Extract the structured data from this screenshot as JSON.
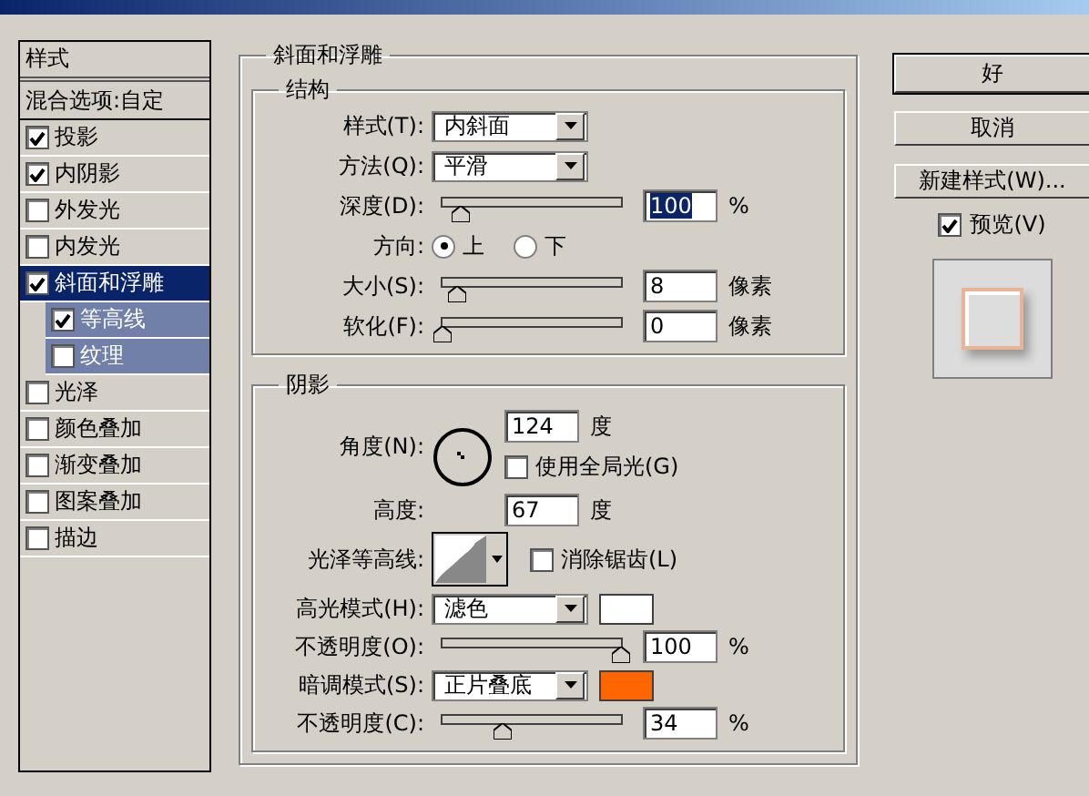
{
  "sidebar": {
    "header": "样式",
    "blend": "混合选项:自定",
    "items": [
      {
        "label": "投影",
        "checked": true,
        "selected": false
      },
      {
        "label": "内阴影",
        "checked": true,
        "selected": false
      },
      {
        "label": "外发光",
        "checked": false,
        "selected": false
      },
      {
        "label": "内发光",
        "checked": false,
        "selected": false
      },
      {
        "label": "斜面和浮雕",
        "checked": true,
        "selected": true,
        "children": [
          {
            "label": "等高线",
            "checked": true,
            "selected": false
          },
          {
            "label": "纹理",
            "checked": false,
            "selected": false
          }
        ]
      },
      {
        "label": "光泽",
        "checked": false,
        "selected": false
      },
      {
        "label": "颜色叠加",
        "checked": false,
        "selected": false
      },
      {
        "label": "渐变叠加",
        "checked": false,
        "selected": false
      },
      {
        "label": "图案叠加",
        "checked": false,
        "selected": false
      },
      {
        "label": "描边",
        "checked": false,
        "selected": false
      }
    ]
  },
  "bevel": {
    "title": "斜面和浮雕",
    "structure": {
      "title": "结构",
      "style": {
        "label": "样式(T):",
        "value": "内斜面"
      },
      "technique": {
        "label": "方法(Q):",
        "value": "平滑"
      },
      "depth": {
        "label": "深度(D):",
        "level": 0.1,
        "value": "100",
        "unit": "%",
        "highlighted": true
      },
      "direction": {
        "label": "方向:",
        "options": [
          {
            "label": "上",
            "selected": true
          },
          {
            "label": "下",
            "selected": false
          }
        ]
      },
      "size": {
        "label": "大小(S):",
        "level": 0.08,
        "value": "8",
        "unit": "像素",
        "highlighted": false
      },
      "soften": {
        "label": "软化(F):",
        "level": 0,
        "value": "0",
        "unit": "像素",
        "highlighted": false
      }
    },
    "shading": {
      "title": "阴影",
      "angle": {
        "label": "角度(N):",
        "value": "124",
        "unit": "度"
      },
      "global_light": {
        "label": "使用全局光(G)",
        "checked": false
      },
      "altitude": {
        "label": "高度:",
        "value": "67",
        "unit": "度"
      },
      "gloss_contour": {
        "label": "光泽等高线:"
      },
      "anti_alias": {
        "label": "消除锯齿(L)",
        "checked": false
      },
      "highlight_mode": {
        "label": "高光模式(H):",
        "value": "滤色",
        "color": "#ffffff"
      },
      "highlight_opacity": {
        "label": "不透明度(O):",
        "level": 1,
        "value": "100",
        "unit": "%",
        "highlighted": false
      },
      "shadow_mode": {
        "label": "暗调模式(S):",
        "value": "正片叠底",
        "color": "#ff6600"
      },
      "shadow_opacity": {
        "label": "不透明度(C):",
        "level": 0.34,
        "value": "34",
        "unit": "%",
        "highlighted": false
      }
    }
  },
  "buttons": [
    {
      "label": "好",
      "default": true
    },
    {
      "label": "取消",
      "default": false
    },
    {
      "label": "新建样式(W)...",
      "default": false
    }
  ],
  "preview": {
    "label": "预览(V)",
    "checked": true
  }
}
